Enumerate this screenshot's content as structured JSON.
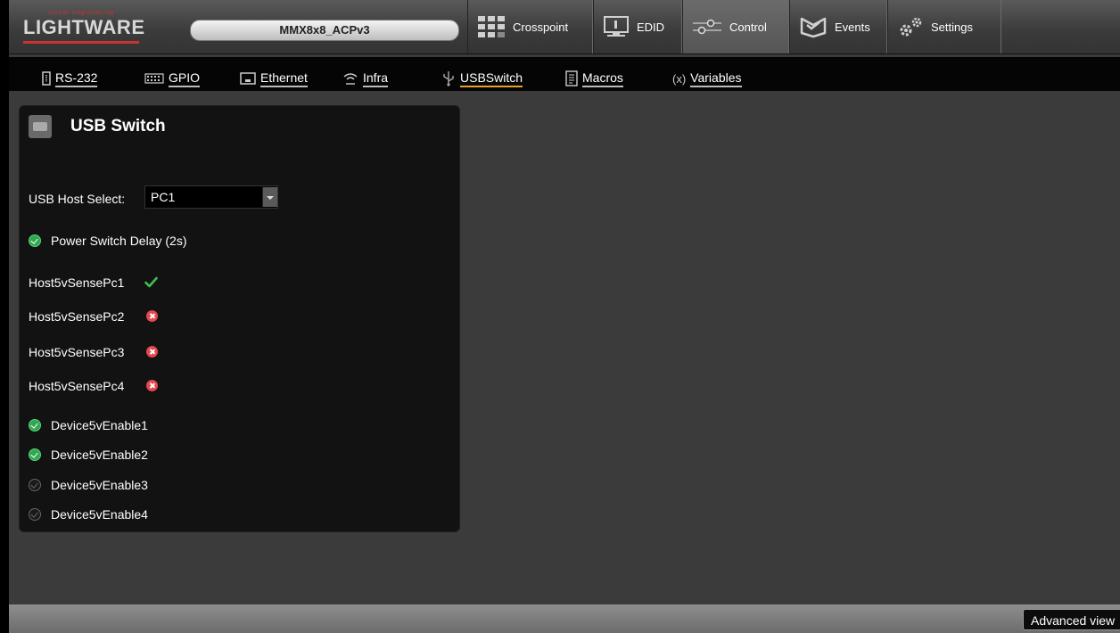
{
  "header": {
    "logo": {
      "tagline": "visual engineering",
      "brand": "LIGHTWARE"
    },
    "device_name": "MMX8x8_ACPv3",
    "nav": [
      {
        "label": "Crosspoint",
        "icon": "crosspoint-icon"
      },
      {
        "label": "EDID",
        "icon": "monitor-icon"
      },
      {
        "label": "Control",
        "icon": "sliders-icon",
        "active": true
      },
      {
        "label": "Events",
        "icon": "events-icon"
      },
      {
        "label": "Settings",
        "icon": "gears-icon"
      }
    ]
  },
  "tabs": [
    {
      "label": "RS-232",
      "icon": "serial-port-icon"
    },
    {
      "label": "GPIO",
      "icon": "gpio-icon"
    },
    {
      "label": "Ethernet",
      "icon": "ethernet-icon"
    },
    {
      "label": "Infra",
      "icon": "infrared-icon"
    },
    {
      "label": "USBSwitch",
      "icon": "usb-icon",
      "active": true
    },
    {
      "label": "Macros",
      "icon": "macro-icon"
    },
    {
      "label": "Variables",
      "icon": "variable-icon"
    }
  ],
  "panel": {
    "title": "USB Switch",
    "host_select": {
      "label": "USB Host Select:",
      "value": "PC1"
    },
    "power_switch_delay": {
      "label": "Power Switch Delay (2s)",
      "checked": true
    },
    "host_sense": [
      {
        "label": "Host5vSensePc1",
        "status": "ok"
      },
      {
        "label": "Host5vSensePc2",
        "status": "error"
      },
      {
        "label": "Host5vSensePc3",
        "status": "error"
      },
      {
        "label": "Host5vSensePc4",
        "status": "error"
      }
    ],
    "device_enable": [
      {
        "label": "Device5vEnable1",
        "checked": true
      },
      {
        "label": "Device5vEnable2",
        "checked": true
      },
      {
        "label": "Device5vEnable3",
        "checked": false
      },
      {
        "label": "Device5vEnable4",
        "checked": false
      }
    ]
  },
  "footer": {
    "advanced_view_label": "Advanced view"
  },
  "colors": {
    "accent": "#e8a22c",
    "ok": "#2fa84f",
    "error": "#e4474d"
  }
}
